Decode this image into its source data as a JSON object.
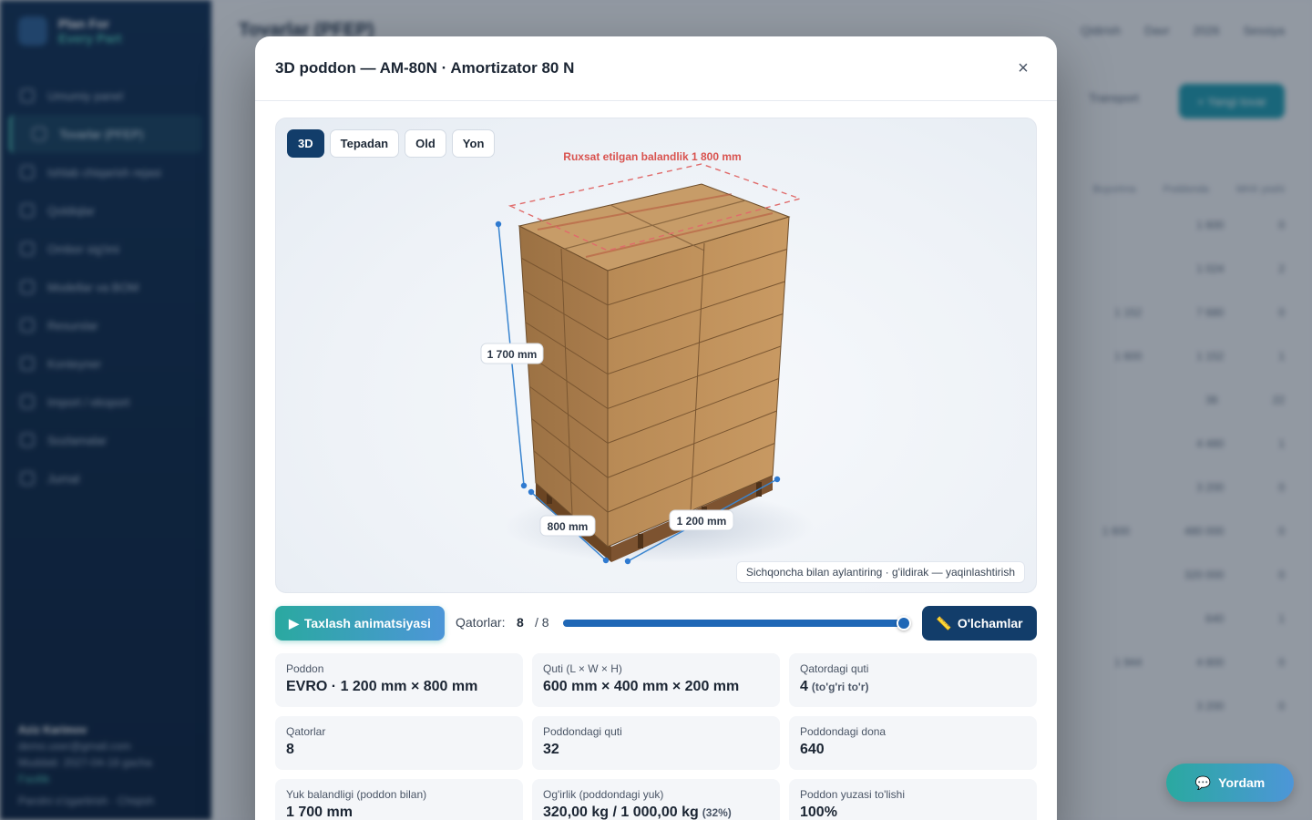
{
  "background": {
    "brand_line1": "Plan For",
    "brand_line2": "Every Part",
    "nav": [
      "Umumiy panel",
      "Tovarlar (PFEP)",
      "Ishlab chiqarish rejasi",
      "Qoldiqlar",
      "Ombor sig'imi",
      "Modellar va BOM",
      "Resurslar",
      "Konteyner",
      "Import / eksport",
      "Sozlamalar",
      "Jurnal"
    ],
    "page_title": "Tovarlar (PFEP)",
    "topbar": [
      "Qidirish",
      "Davr",
      "2026",
      "Sessiya"
    ],
    "new_button": "+ Yangi tovar",
    "transport_label": "Transport",
    "table_headers": [
      "Buyurtma",
      "Poddonda",
      "MHX yoshi"
    ],
    "table_values": [
      [
        "",
        "1 600",
        "0"
      ],
      [
        "",
        "1 024",
        "2"
      ],
      [
        "1 152",
        "7 680",
        "0"
      ],
      [
        "1 600",
        "1 152",
        "1"
      ],
      [
        "",
        "36",
        "22"
      ],
      [
        "",
        "4 480",
        "1"
      ],
      [
        "",
        "3 200",
        "0"
      ],
      [
        "1 600",
        "480 000",
        "0"
      ],
      [
        "",
        "320 000",
        "0"
      ],
      [
        "",
        "640",
        "1"
      ],
      [
        "1 944",
        "4 800",
        "0"
      ],
      [
        "",
        "3 200",
        "0"
      ]
    ],
    "user_name": "Aziz Karimov",
    "user_email": "demo.user@gmail.com",
    "user_plan": "Muddati: 2027-04-18 gacha",
    "user_status": "Faollik",
    "user_links": "Parolni o'zgartirish · Chiqish"
  },
  "modal": {
    "title": "3D poddon — AM-80N · Amortizator 80 N",
    "close_label": "×",
    "view_tabs": [
      {
        "label": "3D",
        "active": true
      },
      {
        "label": "Tepadan",
        "active": false
      },
      {
        "label": "Old",
        "active": false
      },
      {
        "label": "Yon",
        "active": false
      }
    ],
    "allowed_height_label": "Ruxsat etilgan balandlik 1 800 mm",
    "height_label": "1 700 mm",
    "depth_label": "800 mm",
    "width_label": "1 200 mm",
    "hint": "Sichqoncha bilan aylantiring · g'ildirak — yaqinlashtirish",
    "anim_button": "Taxlash animatsiyasi",
    "rows_label": "Qatorlar:",
    "rows_current": "8",
    "rows_total": "/ 8",
    "rows_fraction": 1.0,
    "dims_button": "O'lchamlar",
    "stats": [
      {
        "label": "Poddon",
        "value": "EVRO · 1 200 mm × 800 mm",
        "note": ""
      },
      {
        "label": "Quti (L × W × H)",
        "value": "600 mm × 400 mm × 200 mm",
        "note": ""
      },
      {
        "label": "Qatordagi quti",
        "value": "4",
        "note": "(to'g'ri to'r)"
      },
      {
        "label": "Qatorlar",
        "value": "8",
        "note": ""
      },
      {
        "label": "Poddondagi quti",
        "value": "32",
        "note": ""
      },
      {
        "label": "Poddondagi dona",
        "value": "640",
        "note": ""
      },
      {
        "label": "Yuk balandligi (poddon bilan)",
        "value": "1 700 mm",
        "note": ""
      },
      {
        "label": "Og'irlik (poddondagi yuk)",
        "value": "320,00 kg / 1 000,00 kg",
        "note": "(32%)"
      },
      {
        "label": "Poddon yuzasi to'lishi",
        "value": "100%",
        "note": ""
      }
    ]
  },
  "help_button": "Yordam",
  "colors": {
    "primary": "#123d6a",
    "accent": "#2aa9a0",
    "limit_red": "#d9534f",
    "box": "#b88a55"
  }
}
